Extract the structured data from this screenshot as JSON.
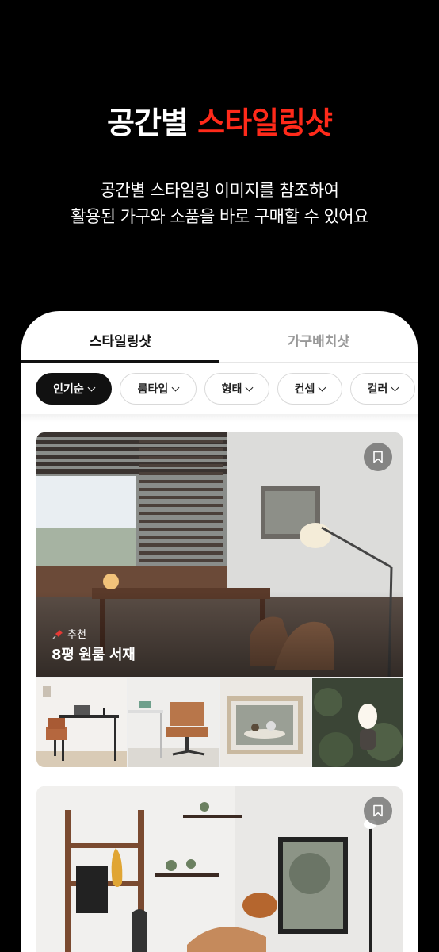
{
  "hero": {
    "title_plain": "공간별 ",
    "title_accent": "스타일링샷",
    "subtitle_line1": "공간별 스타일링 이미지를 참조하여",
    "subtitle_line2": "활용된 가구와 소품을 바로 구매할 수 있어요"
  },
  "tabs": [
    {
      "label": "스타일링샷",
      "active": true
    },
    {
      "label": "가구배치샷",
      "active": false
    }
  ],
  "filters": [
    {
      "label": "인기순",
      "active": true
    },
    {
      "label": "룸타입",
      "active": false
    },
    {
      "label": "형태",
      "active": false
    },
    {
      "label": "컨셉",
      "active": false
    },
    {
      "label": "컬러",
      "active": false
    }
  ],
  "cards": [
    {
      "tag": "추천",
      "title": "8평 원룸 서재",
      "icon": "pin-icon"
    },
    {
      "tag": "",
      "title": ""
    }
  ],
  "colors": {
    "accent": "#ff2a1a",
    "background": "#000000",
    "chip_active": "#111111"
  }
}
